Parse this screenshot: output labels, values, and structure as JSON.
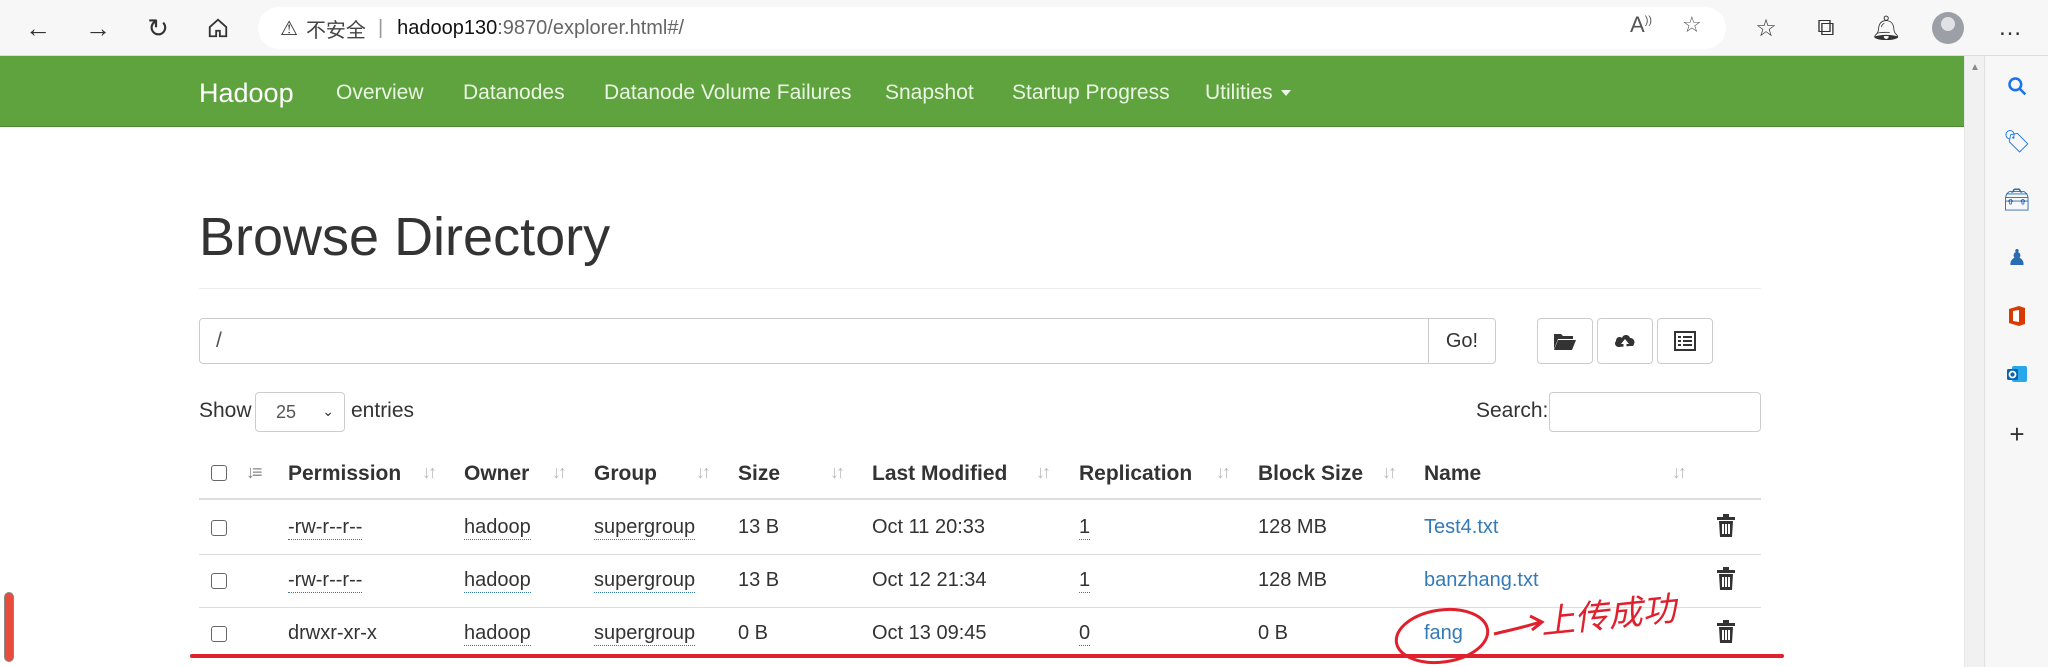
{
  "browser": {
    "address": {
      "insecure_label": "不安全",
      "separator": "|",
      "host": "hadoop130",
      "path": ":9870/explorer.html#/"
    }
  },
  "navbar": {
    "brand": "Hadoop",
    "links": [
      "Overview",
      "Datanodes",
      "Datanode Volume Failures",
      "Snapshot",
      "Startup Progress",
      "Utilities"
    ]
  },
  "page": {
    "title": "Browse Directory",
    "path_value": "/",
    "go_label": "Go!",
    "show_label": "Show",
    "entries_select": "25",
    "entries_label": "entries",
    "search_label": "Search:"
  },
  "table": {
    "columns": [
      "Permission",
      "Owner",
      "Group",
      "Size",
      "Last Modified",
      "Replication",
      "Block Size",
      "Name"
    ],
    "rows": [
      {
        "permission": "-rw-r--r--",
        "owner": "hadoop",
        "group": "supergroup",
        "size": "13 B",
        "modified": "Oct 11 20:33",
        "replication": "1",
        "block_size": "128 MB",
        "name": "Test4.txt"
      },
      {
        "permission": "-rw-r--r--",
        "owner": "hadoop",
        "group": "supergroup",
        "size": "13 B",
        "modified": "Oct 12 21:34",
        "replication": "1",
        "block_size": "128 MB",
        "name": "banzhang.txt"
      },
      {
        "permission": "drwxr-xr-x",
        "owner": "hadoop",
        "group": "supergroup",
        "size": "0 B",
        "modified": "Oct 13 09:45",
        "replication": "0",
        "block_size": "0 B",
        "name": "fang"
      }
    ]
  },
  "annotation": {
    "text": "上传成功",
    "color": "#e0202c"
  },
  "colors": {
    "navbar": "#5fa33e",
    "link": "#337ab7"
  }
}
